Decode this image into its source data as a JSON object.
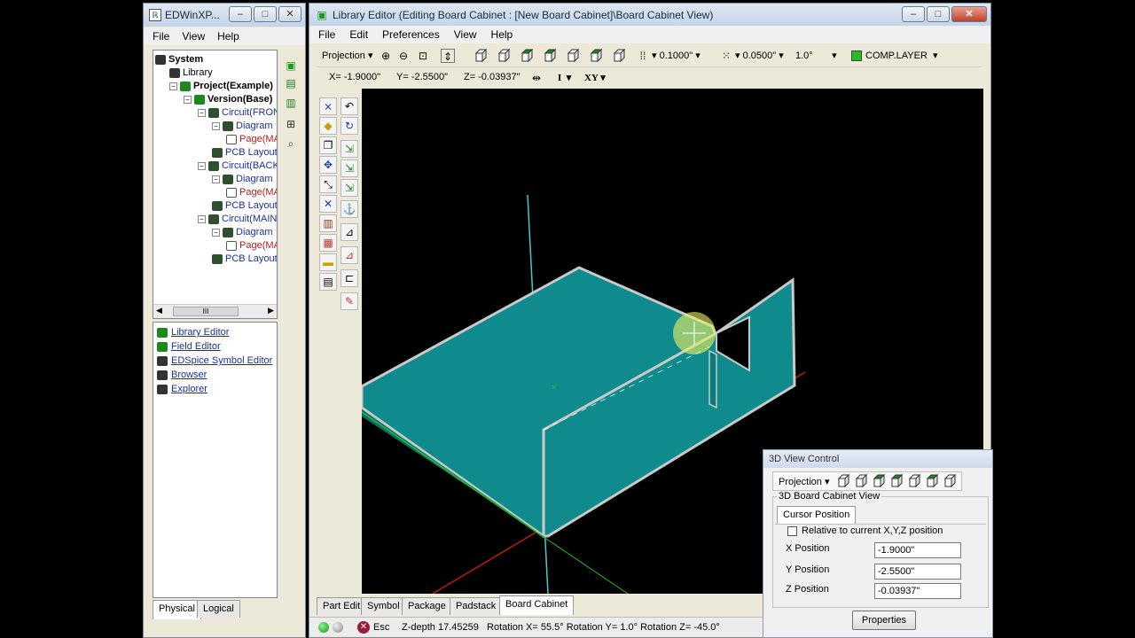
{
  "left_window": {
    "title": "EDWinXP...",
    "menu": [
      "File",
      "View",
      "Help"
    ],
    "tree": [
      {
        "label": "System",
        "indent": 0,
        "style": "bold",
        "exp": ""
      },
      {
        "label": "Library",
        "indent": 1,
        "style": "",
        "exp": ""
      },
      {
        "label": "Project(Example)",
        "indent": 1,
        "style": "bold",
        "exp": "−"
      },
      {
        "label": "Version(Base)",
        "indent": 2,
        "style": "bold",
        "exp": "−"
      },
      {
        "label": "Circuit(FRONTPA",
        "indent": 3,
        "style": "blue",
        "exp": "−"
      },
      {
        "label": "Diagram",
        "indent": 4,
        "style": "blue",
        "exp": "−"
      },
      {
        "label": "Page(MA",
        "indent": 5,
        "style": "red",
        "exp": ""
      },
      {
        "label": "PCB Layout",
        "indent": 4,
        "style": "blue",
        "exp": ""
      },
      {
        "label": "Circuit(BACKPAN",
        "indent": 3,
        "style": "blue",
        "exp": "−"
      },
      {
        "label": "Diagram",
        "indent": 4,
        "style": "blue",
        "exp": "−"
      },
      {
        "label": "Page(MA",
        "indent": 5,
        "style": "red",
        "exp": ""
      },
      {
        "label": "PCB Layout",
        "indent": 4,
        "style": "blue",
        "exp": ""
      },
      {
        "label": "Circuit(MAINHIEI",
        "indent": 3,
        "style": "blue",
        "exp": "−"
      },
      {
        "label": "Diagram",
        "indent": 4,
        "style": "blue",
        "exp": "−"
      },
      {
        "label": "Page(MA",
        "indent": 5,
        "style": "red",
        "exp": ""
      },
      {
        "label": "PCB Layout",
        "indent": 4,
        "style": "blue",
        "exp": ""
      }
    ],
    "scroll_thumb": "III",
    "tools": [
      "Library Editor",
      "Field Editor",
      "EDSpice Symbol Editor",
      "Browser",
      "Explorer"
    ],
    "tabs": [
      "Physical",
      "Logical"
    ]
  },
  "main_window": {
    "title": "Library Editor (Editing Board Cabinet : [New Board Cabinet]\\Board Cabinet View)",
    "menu": [
      "File",
      "Edit",
      "Preferences",
      "View",
      "Help"
    ],
    "toolbar": {
      "projection": "Projection",
      "grid1": "0.1000\"",
      "grid2": "0.0500\"",
      "angle": "1.0°",
      "layer": "COMP.LAYER",
      "layer_color": "#22c022"
    },
    "coords": {
      "x": "X= -1.9000\"",
      "y": "Y= -2.5500\"",
      "z": "Z= -0.03937\"",
      "mode": "I",
      "plane": "XY"
    },
    "bottom_tabs": [
      "Part Edit",
      "Symbol",
      "Package",
      "Padstack",
      "Board Cabinet"
    ],
    "status": {
      "esc": "Esc",
      "info": "Z-depth 17.45259   Rotation X= 55.5° Rotation Y= 1.0° Rotation Z= -45.0°"
    }
  },
  "panel": {
    "title": "3D View Control",
    "projection": "Projection",
    "group": "3D Board Cabinet View",
    "tab": "Cursor Position",
    "checkbox_label": "Relative to current X,Y,Z position",
    "x_label": "X Position",
    "y_label": "Y Position",
    "z_label": "Z Position",
    "x_value": "-1.9000\"",
    "y_value": "-2.5500\"",
    "z_value": "-0.03937\"",
    "properties": "Properties"
  },
  "colors": {
    "board": "#0f8b8d",
    "board_edge": "#c9c9c9"
  }
}
